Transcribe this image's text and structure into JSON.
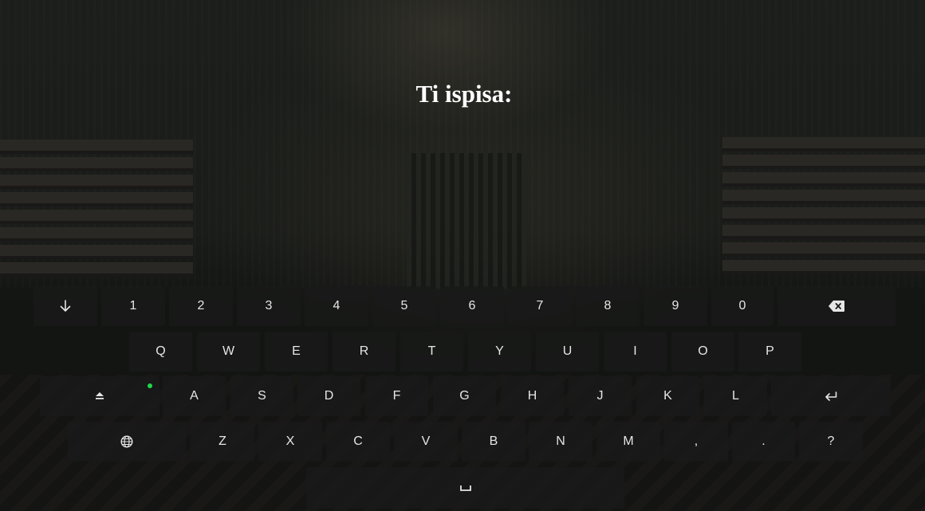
{
  "prompt": {
    "title": "Ti ispisa:"
  },
  "keyboard": {
    "row1": [
      "1",
      "2",
      "3",
      "4",
      "5",
      "6",
      "7",
      "8",
      "9",
      "0"
    ],
    "row2": [
      "Q",
      "W",
      "E",
      "R",
      "T",
      "Y",
      "U",
      "I",
      "O",
      "P"
    ],
    "row3": [
      "A",
      "S",
      "D",
      "F",
      "G",
      "H",
      "J",
      "K",
      "L"
    ],
    "row4": [
      "Z",
      "X",
      "C",
      "V",
      "B",
      "N",
      "M",
      ",",
      ".",
      "?"
    ],
    "special_keys": {
      "hide": "arrow-down-icon",
      "backspace": "backspace-icon",
      "shift": "shift-icon",
      "enter": "enter-icon",
      "language": "globe-icon",
      "space": "space-icon"
    },
    "shift_indicator_color": "#21d84a"
  }
}
